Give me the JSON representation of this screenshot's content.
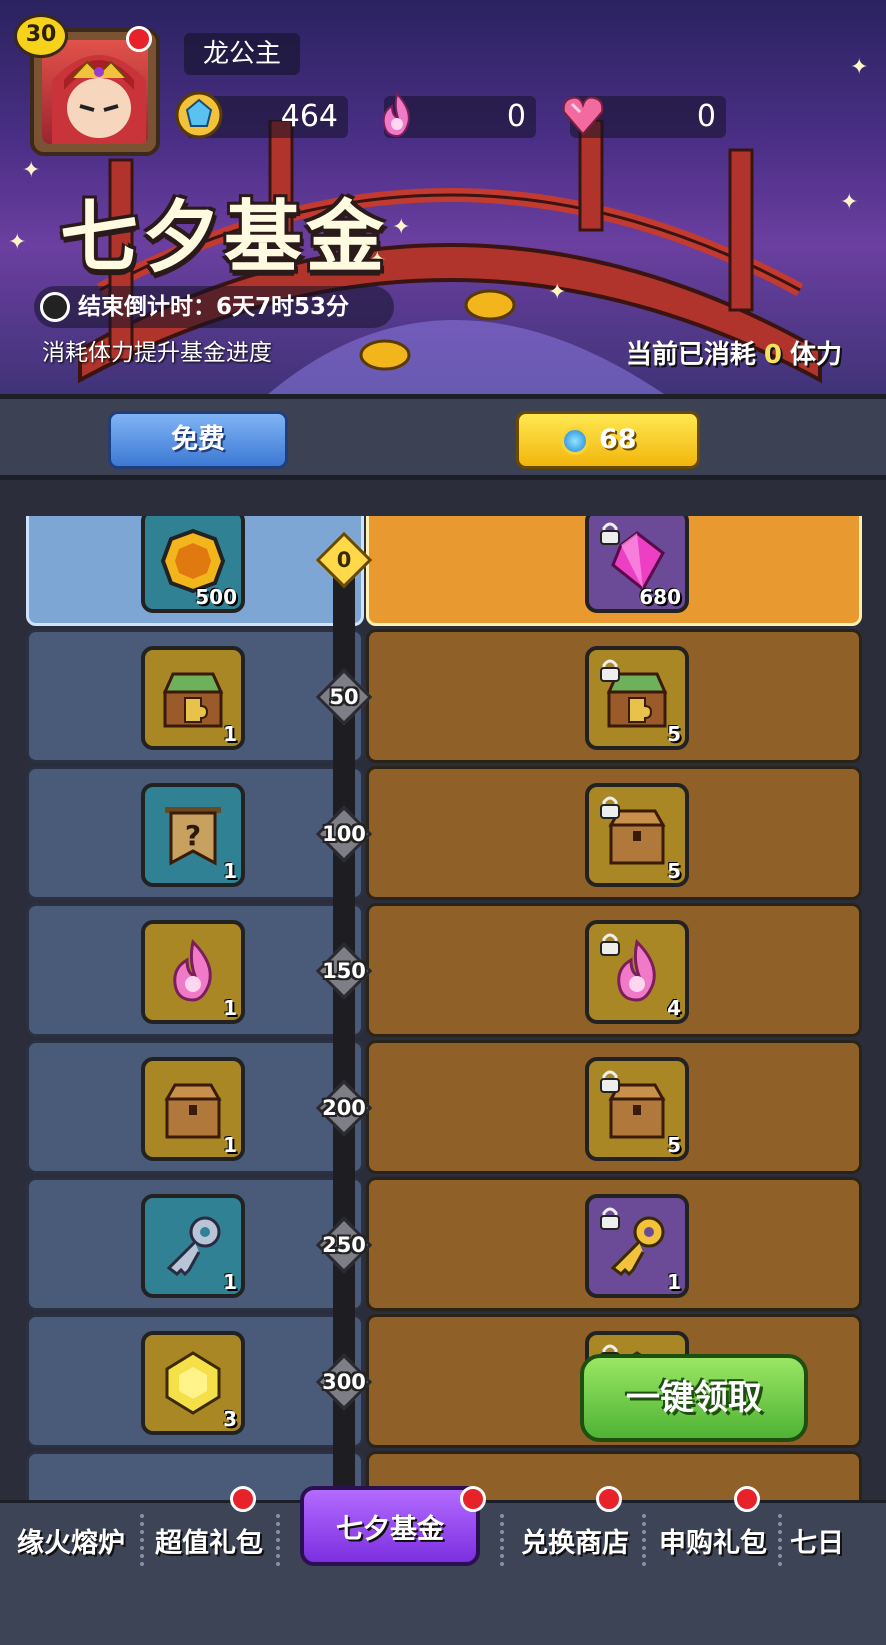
{
  "player": {
    "level": "30",
    "name": "龙公主"
  },
  "resources": [
    {
      "icon": "gem-coin-icon",
      "value": "464"
    },
    {
      "icon": "pink-flame-icon",
      "value": "0"
    },
    {
      "icon": "crystal-heart-icon",
      "value": "0"
    }
  ],
  "event": {
    "title": "七夕基金",
    "countdown": "结束倒计时：6天7时53分",
    "description": "消耗体力提升基金进度",
    "consumed_prefix": "当前已消耗",
    "consumed_value": "0",
    "consumed_suffix": "体力"
  },
  "tabs": {
    "free_label": "免费",
    "paid_price": "68"
  },
  "tiers": [
    {
      "threshold": "0",
      "free": {
        "icon": "gold-coin-icon",
        "qty": "500"
      },
      "paid": {
        "icon": "pink-gem-icon",
        "qty": "680"
      }
    },
    {
      "threshold": "50",
      "free": {
        "icon": "puzzle-chest-icon",
        "qty": "1"
      },
      "paid": {
        "icon": "puzzle-chest-icon",
        "qty": "5"
      }
    },
    {
      "threshold": "100",
      "free": {
        "icon": "mystery-banner-icon",
        "qty": "1"
      },
      "paid": {
        "icon": "wooden-chest-icon",
        "qty": "5"
      }
    },
    {
      "threshold": "150",
      "free": {
        "icon": "pink-flame-icon",
        "qty": "1"
      },
      "paid": {
        "icon": "pink-flame-icon",
        "qty": "4"
      }
    },
    {
      "threshold": "200",
      "free": {
        "icon": "wooden-chest-icon",
        "qty": "1"
      },
      "paid": {
        "icon": "wooden-chest-icon",
        "qty": "5"
      }
    },
    {
      "threshold": "250",
      "free": {
        "icon": "silver-key-icon",
        "qty": "1"
      },
      "paid": {
        "icon": "gold-key-icon",
        "qty": "1"
      }
    },
    {
      "threshold": "300",
      "free": {
        "icon": "yellow-gem-icon",
        "qty": "3"
      },
      "paid": {
        "icon": "yellow-gem-icon",
        "qty": ""
      }
    },
    {
      "threshold": "",
      "free": {
        "icon": "",
        "qty": ""
      },
      "paid": {
        "icon": "",
        "qty": ""
      }
    }
  ],
  "claim_all_label": "一键领取",
  "bottom_nav": [
    "缘火熔炉",
    "超值礼包",
    "七夕基金",
    "兑换商店",
    "申购礼包",
    "七日"
  ],
  "colors": {
    "free_column": "#4a5b7a",
    "paid_column": "#8f6028",
    "claim_button": "#5fc23c",
    "selected_tab": "#8f3ff0"
  }
}
